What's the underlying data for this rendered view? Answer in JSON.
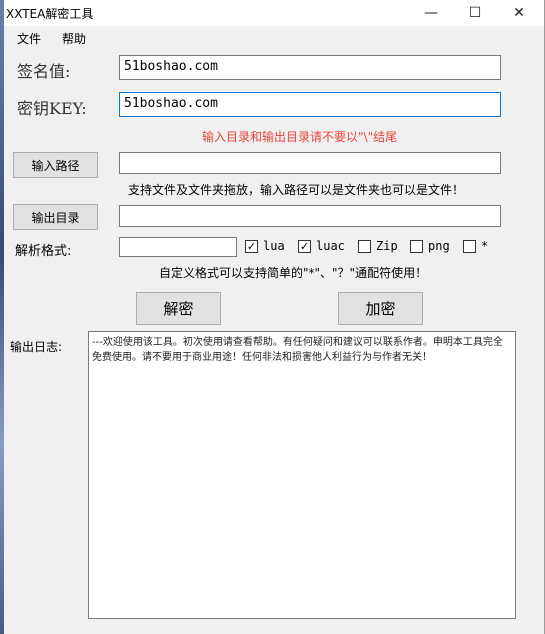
{
  "window": {
    "title": "XXTEA解密工具",
    "minimize_glyph": "—",
    "maximize_glyph": "☐",
    "close_glyph": "✕"
  },
  "menu": {
    "file": "文件",
    "help": "帮助"
  },
  "sign": {
    "label": "签名值:",
    "value": "51boshao.com"
  },
  "key": {
    "label": "密钥KEY:",
    "value": "51boshao.com"
  },
  "warning": "输入目录和输出目录请不要以\"\\\"结尾",
  "input_path": {
    "button": "输入路径",
    "value": "",
    "hint": "支持文件及文件夹拖放，输入路径可以是文件夹也可以是文件！"
  },
  "output_dir": {
    "button": "输出目录",
    "value": ""
  },
  "format": {
    "label": "解析格式:",
    "value": "",
    "options": [
      {
        "label": "lua",
        "checked": true
      },
      {
        "label": "luac",
        "checked": true
      },
      {
        "label": "Zip",
        "checked": false
      },
      {
        "label": "png",
        "checked": false
      },
      {
        "label": "*",
        "checked": false
      }
    ],
    "hint": "自定义格式可以支持简单的\"*\"、\"？\"通配符使用！"
  },
  "actions": {
    "decrypt": "解密",
    "encrypt": "加密"
  },
  "log": {
    "label": "输出日志:",
    "text": "---欢迎使用该工具。初次使用请查看帮助。有任何疑问和建议可以联系作者。申明本工具完全免费使用。请不要用于商业用途！任何非法和损害他人利益行为与作者无关！"
  }
}
